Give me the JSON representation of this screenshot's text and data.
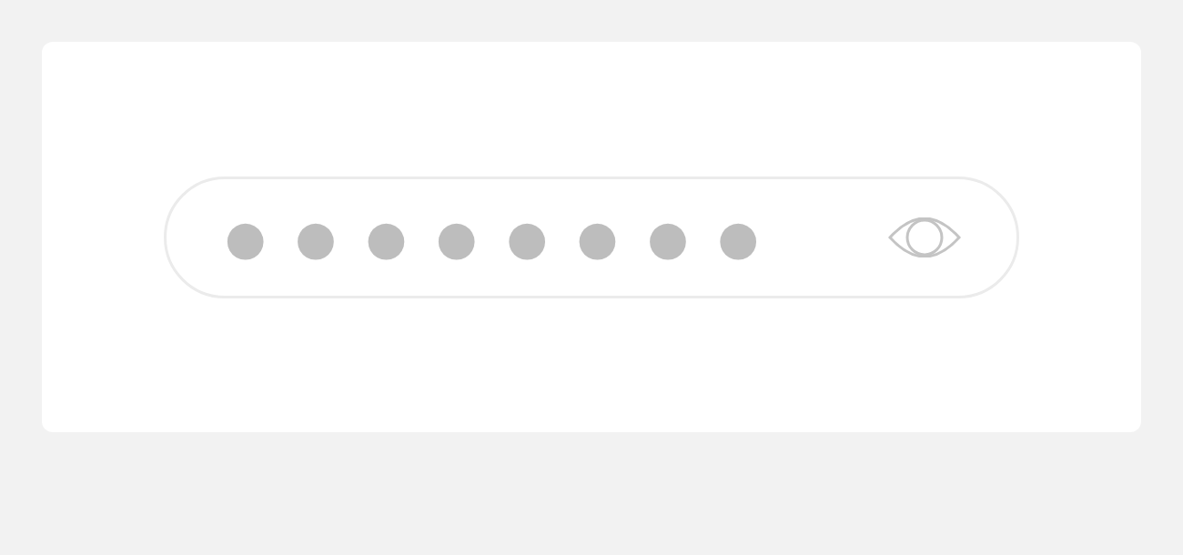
{
  "password_field": {
    "value": "●●●●●●●●"
  }
}
